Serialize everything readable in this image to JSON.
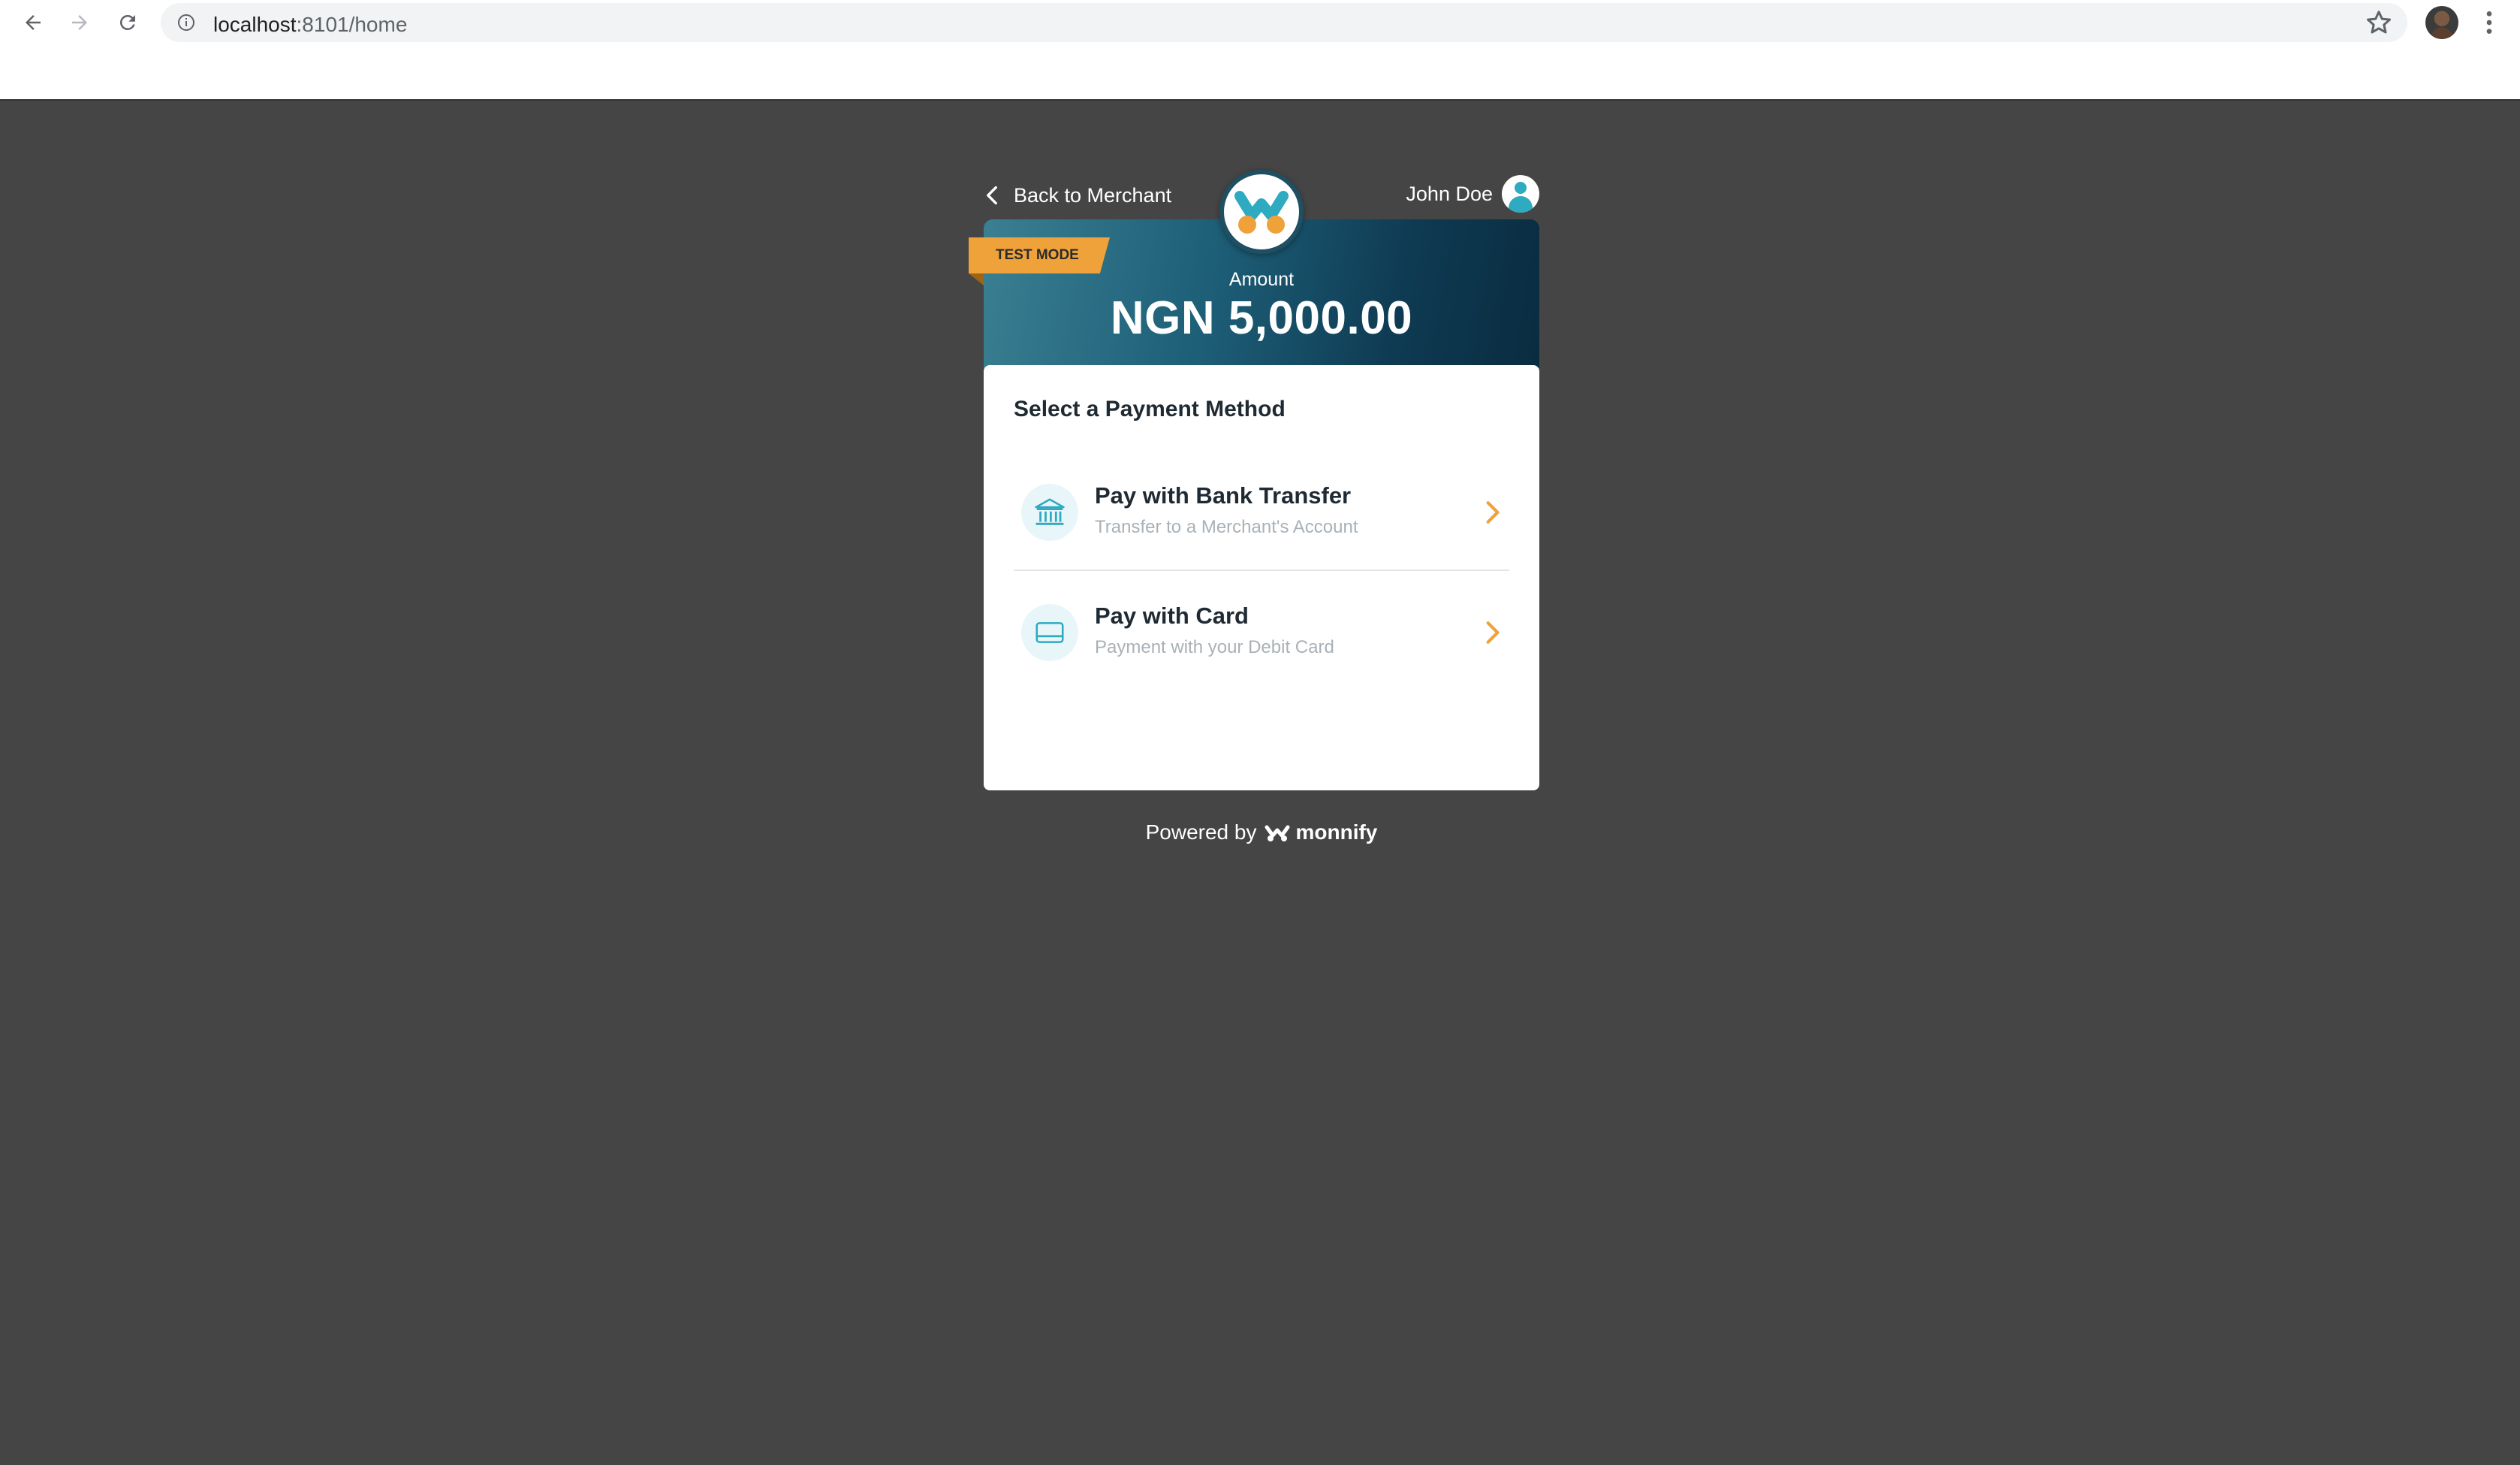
{
  "browser": {
    "url_host": "localhost",
    "url_path": ":8101/home"
  },
  "checkout": {
    "back_label": "Back to Merchant",
    "user_name": "John Doe",
    "test_mode_label": "TEST MODE",
    "amount_label": "Amount",
    "amount_value": "NGN 5,000.00",
    "card_title": "Select a Payment Method",
    "methods": [
      {
        "title": "Pay with Bank Transfer",
        "subtitle": "Transfer to a Merchant's Account",
        "icon": "bank-icon"
      },
      {
        "title": "Pay with Card",
        "subtitle": "Payment with your Debit Card",
        "icon": "card-icon"
      }
    ],
    "powered_by": "Powered by",
    "brand": "monnify"
  },
  "colors": {
    "page_bg": "#454545",
    "accent_orange": "#f0a23a",
    "teal": "#2eaac1",
    "banner_dark": "#0a2c40"
  }
}
